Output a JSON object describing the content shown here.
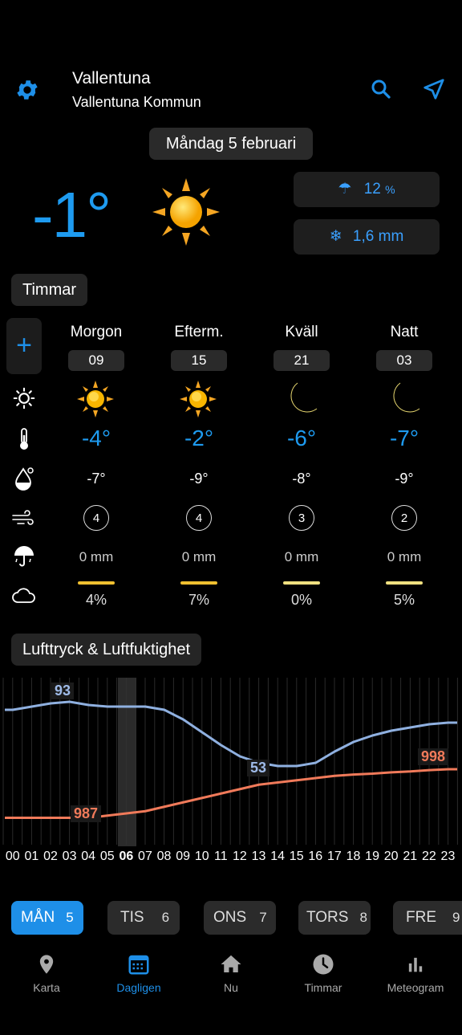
{
  "header": {
    "city": "Vallentuna",
    "municipality": "Vallentuna Kommun"
  },
  "date": "Måndag 5 februari",
  "current": {
    "temp": "-1°",
    "rain_chance": "12",
    "rain_unit": "%",
    "snow_amount": "1,6 mm"
  },
  "sections": {
    "hours": "Timmar",
    "pressure": "Lufttryck & Luftfuktighet"
  },
  "periods": [
    {
      "name": "Morgon",
      "hour": "09",
      "icon": "sun-icon",
      "temp": "-4°",
      "feels": "-7°",
      "wind": "4",
      "precip": "0 mm",
      "cloud": "4%",
      "cloud_color": "#f0c030"
    },
    {
      "name": "Efterm.",
      "hour": "15",
      "icon": "sun-icon",
      "temp": "-2°",
      "feels": "-9°",
      "wind": "4",
      "precip": "0 mm",
      "cloud": "7%",
      "cloud_color": "#f0c030"
    },
    {
      "name": "Kväll",
      "hour": "21",
      "icon": "moon-icon",
      "temp": "-6°",
      "feels": "-8°",
      "wind": "3",
      "precip": "0 mm",
      "cloud": "0%",
      "cloud_color": "#f0e080"
    },
    {
      "name": "Natt",
      "hour": "03",
      "icon": "moon-icon",
      "temp": "-7°",
      "feels": "-9°",
      "wind": "2",
      "precip": "0 mm",
      "cloud": "5%",
      "cloud_color": "#f0e080"
    }
  ],
  "chart_labels": {
    "humidity_high": "93",
    "humidity_low": "53",
    "pressure_low": "987",
    "pressure_high": "998"
  },
  "chart_data": {
    "type": "line",
    "x": [
      "00",
      "01",
      "02",
      "03",
      "04",
      "05",
      "06",
      "07",
      "08",
      "09",
      "10",
      "11",
      "12",
      "13",
      "14",
      "15",
      "16",
      "17",
      "18",
      "19",
      "20",
      "21",
      "22",
      "23"
    ],
    "series": [
      {
        "values": [
          88,
          90,
          92,
          93,
          91,
          90,
          90,
          90,
          88,
          82,
          74,
          66,
          59,
          55,
          53,
          53,
          55,
          62,
          68,
          72,
          75,
          77,
          79,
          80
        ]
      },
      {
        "values": [
          987,
          987,
          987,
          987,
          987,
          987.5,
          988,
          988.5,
          989.5,
          990.5,
          991.5,
          992.5,
          993.5,
          994.5,
          995,
          995.5,
          996,
          996.5,
          996.8,
          997,
          997.3,
          997.5,
          997.8,
          998
        ]
      }
    ],
    "highlight_hour": "06",
    "xlabel": "",
    "ylabel": ""
  },
  "day_tabs": [
    {
      "label": "MÅN",
      "num": "5"
    },
    {
      "label": "TIS",
      "num": "6"
    },
    {
      "label": "ONS",
      "num": "7"
    },
    {
      "label": "TORS",
      "num": "8"
    },
    {
      "label": "FRE",
      "num": "9"
    }
  ],
  "nav": {
    "map": "Karta",
    "daily": "Dagligen",
    "now": "Nu",
    "hours": "Timmar",
    "meteogram": "Meteogram"
  },
  "colors": {
    "accent": "#1e8fe8",
    "humidity": "#8fb0e0",
    "pressure": "#f07a5a"
  }
}
